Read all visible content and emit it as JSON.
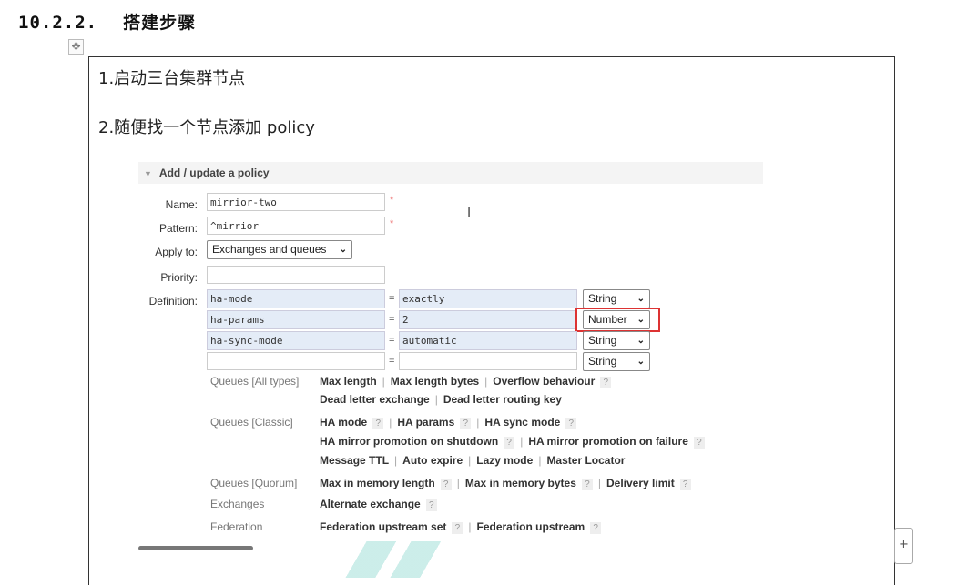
{
  "heading": {
    "number": "10.2.2.",
    "title": "搭建步骤"
  },
  "steps": [
    "1.启动三台集群节点",
    "2.随便找一个节点添加 policy"
  ],
  "policy_form": {
    "section_title": "Add / update a policy",
    "name_label": "Name:",
    "name_value": "mirrior-two",
    "pattern_label": "Pattern:",
    "pattern_value": "^mirrior",
    "apply_label": "Apply to:",
    "apply_value": "Exchanges and queues",
    "priority_label": "Priority:",
    "priority_value": "",
    "definition_label": "Definition:",
    "definition_rows": [
      {
        "key": "ha-mode",
        "value": "exactly",
        "type": "String"
      },
      {
        "key": "ha-params",
        "value": "2",
        "type": "Number"
      },
      {
        "key": "ha-sync-mode",
        "value": "automatic",
        "type": "String"
      },
      {
        "key": "",
        "value": "",
        "type": "String"
      }
    ],
    "required_mark": "*",
    "equals": "=",
    "groups": [
      {
        "label": "Queues [All types]",
        "lines": [
          [
            "Max length",
            "Max length bytes",
            "Overflow behaviour"
          ],
          [
            "Dead letter exchange",
            "Dead letter routing key"
          ]
        ]
      },
      {
        "label": "Queues [Classic]",
        "lines": [
          [
            "HA mode",
            "HA params",
            "HA sync mode"
          ],
          [
            "HA mirror promotion on shutdown",
            "HA mirror promotion on failure"
          ],
          [
            "Message TTL",
            "Auto expire",
            "Lazy mode",
            "Master Locator"
          ]
        ]
      },
      {
        "label": "Queues [Quorum]",
        "lines": [
          [
            "Max in memory length",
            "Max in memory bytes",
            "Delivery limit"
          ]
        ]
      },
      {
        "label": "Exchanges",
        "lines": [
          [
            "Alternate exchange"
          ]
        ]
      },
      {
        "label": "Federation",
        "lines": [
          [
            "Federation upstream set",
            "Federation upstream"
          ]
        ]
      }
    ],
    "help_mark": "?"
  },
  "cursor_glyph": "I",
  "plus_label": "+",
  "move_glyph": "✥",
  "icons": {
    "collapse": "triangle-down-icon",
    "dropdown": "chevron-down-icon",
    "move": "move-handle-icon"
  },
  "colors": {
    "highlight": "#dd3333",
    "input_fill": "#e4ecf7"
  }
}
